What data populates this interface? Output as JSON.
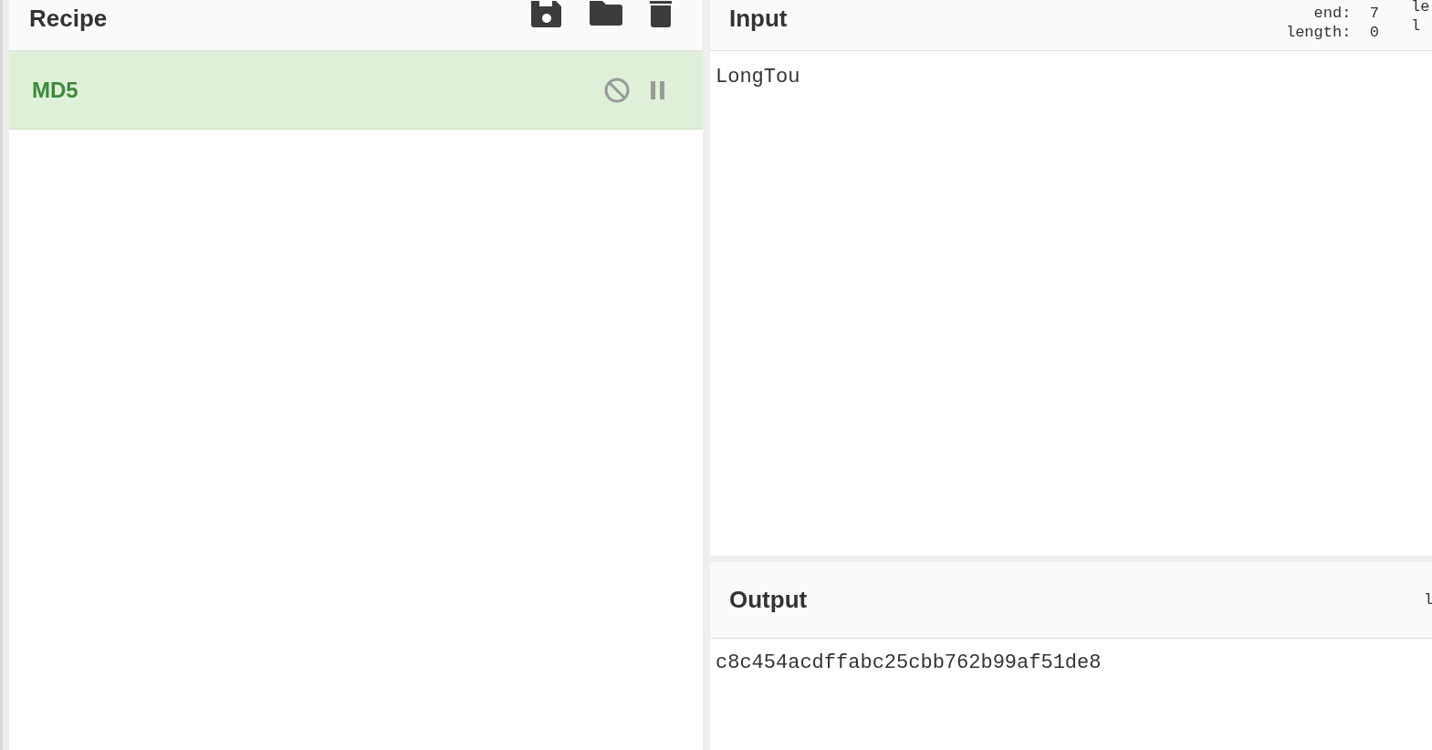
{
  "recipe": {
    "title": "Recipe",
    "operations": [
      {
        "name": "MD5",
        "disabled": false,
        "breakpoint": false
      }
    ]
  },
  "input": {
    "title": "Input",
    "stats": [
      {
        "label": "end:",
        "value": "7"
      },
      {
        "label": "length:",
        "value": "0"
      }
    ],
    "cut_stats": [
      "le",
      "l"
    ],
    "value": "LongTou"
  },
  "output": {
    "title": "Output",
    "cut_stats": [
      "l"
    ],
    "value": "c8c454acdffabc25cbb762b99af51de8"
  }
}
